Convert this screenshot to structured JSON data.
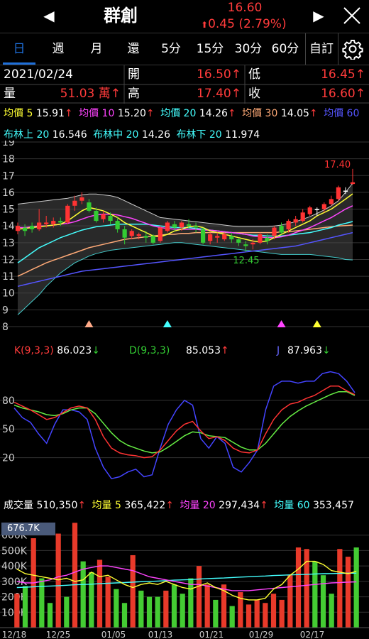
{
  "header": {
    "title": "群創",
    "price": "16.60",
    "change": "0.45 (2.79%)",
    "change_arrow": "⬆"
  },
  "tabs": [
    "日",
    "週",
    "月",
    "還",
    "5分",
    "15分",
    "30分",
    "60分"
  ],
  "active_tab": "日",
  "custom_label": "自訂",
  "info": {
    "date": "2021/02/24",
    "open_label": "開",
    "open_value": "16.50↑",
    "low_label": "低",
    "low_value": "16.45↑",
    "volume_label": "量",
    "volume_value": "51.03 萬↑",
    "high_label": "高",
    "high_value": "17.40↑",
    "close_label": "收",
    "close_value": "16.60↑"
  },
  "ma_legend": [
    {
      "label": "均價 5",
      "value": "15.91",
      "arrow": "↑",
      "color": "#ffff33"
    },
    {
      "label": "均價 10",
      "value": "15.20",
      "arrow": "↑",
      "color": "#ff44ff"
    },
    {
      "label": "均價 20",
      "value": "14.26",
      "arrow": "↑",
      "color": "#44ffff"
    },
    {
      "label": "均價 30",
      "value": "14.05",
      "arrow": "↑",
      "color": "#ffaa77"
    },
    {
      "label": "均價 60",
      "value": "",
      "arrow": "",
      "color": "#5555ff"
    }
  ],
  "boll_legend": [
    {
      "label": "布林上 20",
      "value": "16.546"
    },
    {
      "label": "布林中 20",
      "value": "14.26"
    },
    {
      "label": "布林下 20",
      "value": "11.974"
    }
  ],
  "kd_legend": {
    "k_label": "K(9,3,3)",
    "k_value": "86.023",
    "k_arrow": "↓",
    "d_label": "D(9,3,3)",
    "d_value": "85.053",
    "d_arrow": "↑",
    "j_label": "J",
    "j_value": "87.963",
    "j_arrow": "↓"
  },
  "vol_legend": {
    "vol_label": "成交量",
    "vol_value": "510,350",
    "vol_arrow": "↑",
    "v5_label": "均量 5",
    "v5_value": "365,422",
    "v5_arrow": "↑",
    "v20_label": "均量 20",
    "v20_value": "297,434",
    "v20_arrow": "↑",
    "v60_label": "均量 60",
    "v60_value": "353,457"
  },
  "vol_max_label": "676.7K",
  "chart_data": [
    {
      "type": "candlestick",
      "y_ticks": [
        19,
        18,
        17,
        16,
        15,
        14,
        13,
        12,
        11,
        10,
        9,
        8
      ],
      "ylim": [
        8,
        19
      ],
      "annotations": {
        "high": "17.40",
        "low": "12.45"
      },
      "candles": [
        {
          "o": 13.7,
          "c": 14.0,
          "h": 14.2,
          "l": 13.5
        },
        {
          "o": 13.9,
          "c": 13.7,
          "h": 14.1,
          "l": 13.4
        },
        {
          "o": 14.0,
          "c": 13.8,
          "h": 14.2,
          "l": 13.6
        },
        {
          "o": 13.8,
          "c": 14.2,
          "h": 15.0,
          "l": 13.7
        },
        {
          "o": 14.1,
          "c": 14.2,
          "h": 14.6,
          "l": 13.9
        },
        {
          "o": 14.1,
          "c": 14.3,
          "h": 14.5,
          "l": 13.9
        },
        {
          "o": 14.3,
          "c": 14.2,
          "h": 14.5,
          "l": 14.0
        },
        {
          "o": 14.2,
          "c": 15.2,
          "h": 15.3,
          "l": 14.1
        },
        {
          "o": 15.2,
          "c": 15.5,
          "h": 15.8,
          "l": 14.9
        },
        {
          "o": 15.5,
          "c": 15.7,
          "h": 16.0,
          "l": 15.3
        },
        {
          "o": 15.4,
          "c": 14.9,
          "h": 15.6,
          "l": 14.8
        },
        {
          "o": 14.9,
          "c": 14.3,
          "h": 15.1,
          "l": 14.2
        },
        {
          "o": 14.4,
          "c": 14.7,
          "h": 14.9,
          "l": 14.2
        },
        {
          "o": 14.6,
          "c": 14.3,
          "h": 14.8,
          "l": 14.1
        },
        {
          "o": 14.3,
          "c": 13.8,
          "h": 14.5,
          "l": 13.6
        },
        {
          "o": 13.8,
          "c": 13.3,
          "h": 14.0,
          "l": 12.9
        },
        {
          "o": 13.4,
          "c": 13.7,
          "h": 13.8,
          "l": 13.2
        },
        {
          "o": 13.4,
          "c": 13.5,
          "h": 13.6,
          "l": 13.2
        },
        {
          "o": 13.4,
          "c": 13.3,
          "h": 13.7,
          "l": 13.0
        },
        {
          "o": 13.4,
          "c": 13.0,
          "h": 13.5,
          "l": 12.9
        },
        {
          "o": 13.1,
          "c": 13.9,
          "h": 14.0,
          "l": 13.0
        },
        {
          "o": 13.7,
          "c": 14.2,
          "h": 14.3,
          "l": 13.6
        },
        {
          "o": 14.1,
          "c": 13.9,
          "h": 14.3,
          "l": 13.7
        },
        {
          "o": 13.9,
          "c": 14.2,
          "h": 14.3,
          "l": 13.7
        },
        {
          "o": 14.1,
          "c": 14.0,
          "h": 14.4,
          "l": 13.8
        },
        {
          "o": 14.0,
          "c": 13.9,
          "h": 14.2,
          "l": 13.6
        },
        {
          "o": 13.8,
          "c": 13.0,
          "h": 13.9,
          "l": 12.9
        },
        {
          "o": 13.1,
          "c": 13.5,
          "h": 13.6,
          "l": 12.9
        },
        {
          "o": 13.3,
          "c": 13.4,
          "h": 13.6,
          "l": 13.0
        },
        {
          "o": 13.2,
          "c": 13.5,
          "h": 13.6,
          "l": 13.1
        },
        {
          "o": 13.4,
          "c": 13.2,
          "h": 13.6,
          "l": 13.0
        },
        {
          "o": 13.2,
          "c": 13.0,
          "h": 13.3,
          "l": 12.8
        },
        {
          "o": 12.9,
          "c": 12.8,
          "h": 13.1,
          "l": 12.45
        },
        {
          "o": 12.9,
          "c": 13.0,
          "h": 13.2,
          "l": 12.6
        },
        {
          "o": 13.0,
          "c": 13.5,
          "h": 13.6,
          "l": 12.9
        },
        {
          "o": 13.3,
          "c": 13.1,
          "h": 13.5,
          "l": 12.9
        },
        {
          "o": 13.4,
          "c": 13.9,
          "h": 14.0,
          "l": 13.2
        },
        {
          "o": 14.0,
          "c": 13.6,
          "h": 14.2,
          "l": 13.5
        },
        {
          "o": 13.8,
          "c": 14.3,
          "h": 14.4,
          "l": 13.6
        },
        {
          "o": 14.2,
          "c": 14.4,
          "h": 14.6,
          "l": 14.0
        },
        {
          "o": 14.3,
          "c": 14.8,
          "h": 15.0,
          "l": 14.2
        },
        {
          "o": 14.7,
          "c": 15.1,
          "h": 15.2,
          "l": 14.6
        },
        {
          "o": 15.0,
          "c": 15.0,
          "h": 15.1,
          "l": 14.6
        },
        {
          "o": 15.0,
          "c": 15.3,
          "h": 15.4,
          "l": 14.8
        },
        {
          "o": 15.3,
          "c": 15.6,
          "h": 15.8,
          "l": 15.2
        },
        {
          "o": 15.6,
          "c": 16.3,
          "h": 16.4,
          "l": 15.5
        },
        {
          "o": 16.1,
          "c": 16.1,
          "h": 16.3,
          "l": 15.9
        },
        {
          "o": 16.5,
          "c": 16.6,
          "h": 17.4,
          "l": 16.45
        }
      ],
      "markers": [
        {
          "index": 10,
          "color": "#ffaa88"
        },
        {
          "index": 21,
          "color": "#44ffff"
        },
        {
          "index": 37,
          "color": "#ff44ff"
        },
        {
          "index": 42,
          "color": "#ffff33"
        }
      ],
      "series": {
        "boll_upper": [
          15.3,
          15.35,
          15.4,
          15.45,
          15.5,
          15.55,
          15.6,
          15.65,
          15.75,
          15.85,
          15.9,
          15.9,
          15.85,
          15.8,
          15.7,
          15.5,
          15.3,
          15.1,
          14.9,
          14.7,
          14.5,
          14.45,
          14.4,
          14.35,
          14.3,
          14.25,
          14.2,
          14.15,
          14.1,
          14.05,
          14.0,
          13.95,
          13.95,
          13.95,
          13.95,
          13.95,
          14.0,
          14.05,
          14.15,
          14.25,
          14.4,
          14.55,
          14.75,
          14.95,
          15.2,
          15.5,
          16.0,
          16.546
        ],
        "boll_lower": [
          8.7,
          9.1,
          9.5,
          9.9,
          10.4,
          10.8,
          11.2,
          11.5,
          11.8,
          12.0,
          12.2,
          12.35,
          12.45,
          12.55,
          12.6,
          12.65,
          12.7,
          12.75,
          12.8,
          12.85,
          12.9,
          12.95,
          13.0,
          13.0,
          12.95,
          12.9,
          12.85,
          12.8,
          12.75,
          12.7,
          12.65,
          12.6,
          12.55,
          12.5,
          12.45,
          12.4,
          12.35,
          12.3,
          12.3,
          12.3,
          12.3,
          12.3,
          12.25,
          12.2,
          12.15,
          12.1,
          12.0,
          11.974
        ],
        "ma5": [
          13.8,
          13.85,
          13.9,
          13.95,
          14.0,
          14.05,
          14.1,
          14.3,
          14.6,
          14.9,
          15.1,
          15.0,
          14.9,
          14.7,
          14.5,
          14.2,
          14.0,
          13.8,
          13.6,
          13.4,
          13.35,
          13.5,
          13.7,
          13.8,
          13.95,
          14.0,
          13.9,
          13.7,
          13.6,
          13.5,
          13.4,
          13.3,
          13.2,
          13.1,
          13.05,
          13.1,
          13.3,
          13.5,
          13.7,
          13.9,
          14.1,
          14.3,
          14.6,
          14.8,
          15.0,
          15.3,
          15.6,
          15.91
        ],
        "ma10": [
          13.9,
          13.9,
          13.95,
          14.0,
          14.0,
          14.05,
          14.1,
          14.15,
          14.25,
          14.4,
          14.55,
          14.65,
          14.7,
          14.7,
          14.65,
          14.55,
          14.45,
          14.3,
          14.15,
          14.0,
          13.9,
          13.85,
          13.8,
          13.8,
          13.8,
          13.8,
          13.75,
          13.75,
          13.7,
          13.65,
          13.6,
          13.55,
          13.5,
          13.4,
          13.35,
          13.3,
          13.3,
          13.35,
          13.45,
          13.6,
          13.75,
          13.9,
          14.1,
          14.3,
          14.5,
          14.75,
          15.0,
          15.2
        ],
        "ma20": [
          11.8,
          12.1,
          12.4,
          12.7,
          12.9,
          13.1,
          13.3,
          13.45,
          13.6,
          13.75,
          13.85,
          13.95,
          14.0,
          14.05,
          14.1,
          14.1,
          14.1,
          14.1,
          14.1,
          14.05,
          14.0,
          13.95,
          13.9,
          13.9,
          13.9,
          13.85,
          13.8,
          13.75,
          13.7,
          13.65,
          13.6,
          13.55,
          13.5,
          13.45,
          13.45,
          13.4,
          13.4,
          13.4,
          13.45,
          13.5,
          13.55,
          13.6,
          13.7,
          13.8,
          13.9,
          14.05,
          14.15,
          14.26
        ],
        "ma30": [
          11.0,
          11.2,
          11.4,
          11.6,
          11.8,
          11.95,
          12.1,
          12.25,
          12.4,
          12.55,
          12.7,
          12.8,
          12.9,
          13.0,
          13.1,
          13.2,
          13.25,
          13.3,
          13.35,
          13.4,
          13.45,
          13.5,
          13.5,
          13.55,
          13.55,
          13.6,
          13.6,
          13.6,
          13.6,
          13.6,
          13.6,
          13.6,
          13.6,
          13.6,
          13.6,
          13.6,
          13.6,
          13.65,
          13.65,
          13.7,
          13.75,
          13.8,
          13.85,
          13.9,
          13.95,
          14.0,
          14.02,
          14.05
        ],
        "ma60": [
          10.4,
          10.5,
          10.6,
          10.7,
          10.8,
          10.9,
          11.0,
          11.1,
          11.2,
          11.3,
          11.35,
          11.4,
          11.45,
          11.5,
          11.55,
          11.6,
          11.65,
          11.7,
          11.75,
          11.8,
          11.85,
          11.9,
          11.95,
          12.0,
          12.05,
          12.1,
          12.15,
          12.2,
          12.25,
          12.3,
          12.35,
          12.4,
          12.45,
          12.5,
          12.55,
          12.6,
          12.65,
          12.7,
          12.75,
          12.8,
          12.9,
          13.0,
          13.1,
          13.2,
          13.3,
          13.4,
          13.5,
          13.6
        ]
      }
    },
    {
      "type": "line",
      "y_ticks": [
        80,
        50,
        20
      ],
      "ylim": [
        -10,
        120
      ],
      "series": {
        "K": [
          78,
          74,
          70,
          65,
          60,
          62,
          67,
          72,
          74,
          72,
          60,
          42,
          30,
          25,
          23,
          22,
          20,
          21,
          28,
          38,
          48,
          55,
          58,
          48,
          40,
          42,
          38,
          30,
          26,
          25,
          28,
          45,
          60,
          70,
          76,
          78,
          82,
          85,
          90,
          95,
          95,
          90,
          86
        ],
        "D": [
          75,
          72,
          70,
          68,
          65,
          64,
          66,
          70,
          72,
          72,
          66,
          56,
          46,
          38,
          33,
          30,
          27,
          25,
          26,
          31,
          37,
          43,
          47,
          46,
          43,
          42,
          41,
          36,
          31,
          28,
          28,
          35,
          45,
          55,
          63,
          69,
          74,
          78,
          82,
          86,
          89,
          89,
          85
        ],
        "J": [
          72,
          62,
          57,
          45,
          35,
          55,
          70,
          70,
          68,
          60,
          30,
          10,
          -2,
          0,
          5,
          8,
          0,
          2,
          30,
          55,
          70,
          80,
          75,
          40,
          30,
          42,
          35,
          10,
          5,
          15,
          28,
          70,
          95,
          100,
          100,
          98,
          100,
          100,
          108,
          110,
          108,
          100,
          88
        ]
      }
    },
    {
      "type": "bar",
      "y_ticks": [
        "600K",
        "500K",
        "400K",
        "300K",
        "200K",
        "100K"
      ],
      "ylim": [
        0,
        700
      ],
      "x_labels": [
        "12/18",
        "12/25",
        "01/05",
        "01/13",
        "01/21",
        "01/29",
        "02/17"
      ],
      "volumes": [
        220,
        270,
        580,
        320,
        160,
        610,
        200,
        680,
        430,
        360,
        440,
        330,
        250,
        160,
        470,
        240,
        200,
        200,
        240,
        280,
        220,
        320,
        400,
        280,
        180,
        280,
        140,
        230,
        150,
        180,
        160,
        220,
        180,
        340,
        520,
        510,
        430,
        340,
        220,
        510,
        460,
        520
      ],
      "up": [
        true,
        false,
        true,
        false,
        false,
        true,
        false,
        true,
        false,
        false,
        true,
        true,
        false,
        false,
        true,
        false,
        false,
        false,
        true,
        false,
        false,
        false,
        true,
        true,
        false,
        true,
        false,
        true,
        true,
        true,
        true,
        true,
        true,
        true,
        true,
        true,
        false,
        false,
        false,
        true,
        true,
        false
      ],
      "series": {
        "ma5": [
          380,
          350,
          340,
          330,
          320,
          310,
          320,
          300,
          310,
          360,
          330,
          340,
          310,
          280,
          260,
          280,
          290,
          280,
          300,
          280,
          260,
          250,
          270,
          290,
          260,
          240,
          210,
          190,
          180,
          180,
          190,
          250,
          280,
          340,
          380,
          430,
          430,
          410,
          370,
          360,
          350,
          365
        ],
        "ma20": [
          300,
          290,
          290,
          300,
          310,
          330,
          340,
          360,
          380,
          390,
          400,
          400,
          390,
          380,
          370,
          350,
          330,
          320,
          310,
          300,
          290,
          280,
          280,
          270,
          260,
          250,
          240,
          240,
          240,
          245,
          250,
          255,
          260,
          265,
          270,
          275,
          280,
          285,
          290,
          292,
          295,
          297
        ],
        "ma60": [
          260,
          262,
          265,
          268,
          270,
          272,
          275,
          278,
          280,
          282,
          285,
          288,
          290,
          292,
          295,
          298,
          300,
          302,
          305,
          308,
          310,
          312,
          315,
          318,
          320,
          322,
          325,
          328,
          330,
          333,
          335,
          338,
          340,
          342,
          344,
          346,
          348,
          350,
          351,
          352,
          353,
          353
        ]
      }
    }
  ]
}
